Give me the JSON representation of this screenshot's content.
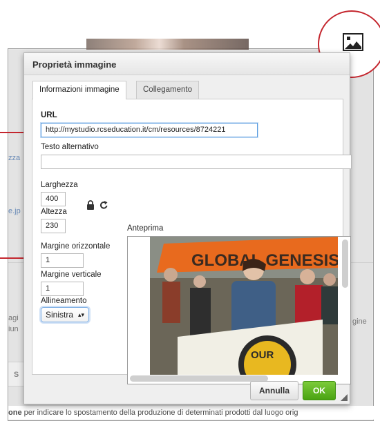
{
  "background": {
    "frag_link1": "zza",
    "frag_link2": "e.jp",
    "frag_agi": "agi",
    "frag_iun": "iun",
    "frag_right": "gine",
    "frag_s": "S",
    "bottom_bold": "one",
    "bottom_text": " per indicare lo spostamento della produzione di determinati prodotti dal luogo orig"
  },
  "dialog": {
    "title": "Proprietà immagine",
    "tabs": [
      {
        "label": "Informazioni immagine",
        "active": true
      },
      {
        "label": "Collegamento",
        "active": false
      }
    ],
    "url_label": "URL",
    "url_value": "http://mystudio.rcseducation.it/cm/resources/8724221",
    "alt_label": "Testo alternativo",
    "alt_value": "",
    "width_label": "Larghezza",
    "width_value": "400",
    "height_label": "Altezza",
    "height_value": "230",
    "preview_label": "Anteprima",
    "hspace_label": "Margine orizzontale",
    "hspace_value": "1",
    "vspace_label": "Margine verticale",
    "vspace_value": "1",
    "align_label": "Allineamento",
    "align_value": "Sinistra",
    "cancel_label": "Annulla",
    "ok_label": "OK",
    "photo_banner_text": "GLOBAL GENESIS",
    "photo_banner2_text": "OUR"
  },
  "icons": {
    "lock": "lock-icon",
    "reset": "reset-size-icon",
    "image": "image-icon"
  },
  "colors": {
    "callout": "#c4262e",
    "ok_button": "#5cb324",
    "focus": "#5a9ce0"
  }
}
